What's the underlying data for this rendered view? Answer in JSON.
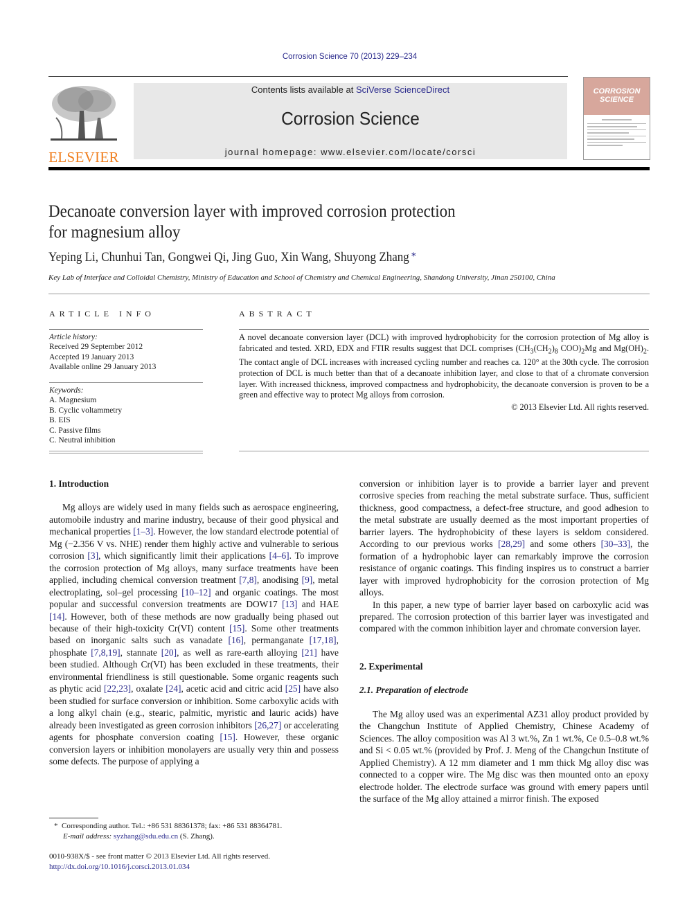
{
  "header": {
    "journal_reference": "Corrosion Science 70 (2013) 229–234",
    "publisher_logo_text": "ELSEVIER",
    "contents_prefix": "Contents lists available at ",
    "contents_link": "SciVerse ScienceDirect",
    "journal_title": "Corrosion Science",
    "homepage_label": "journal homepage: www.elsevier.com/locate/corsci",
    "cover_title_line1": "CORROSION",
    "cover_title_line2": "SCIENCE",
    "colors": {
      "link": "#2a2a8c",
      "elsevier_orange": "#f07e1d",
      "cover_pink": "#d7a79c",
      "banner_gray": "#e8e8e8"
    }
  },
  "article": {
    "title_line1": "Decanoate conversion layer with improved corrosion protection",
    "title_line2": "for magnesium alloy",
    "authors": "Yeping Li, Chunhui Tan, Gongwei Qi, Jing Guo, Xin Wang, Shuyong Zhang",
    "author_mark": "*",
    "affiliation": "Key Lab of Interface and Colloidal Chemistry, Ministry of Education and School of Chemistry and Chemical Engineering, Shandong University, Jinan 250100, China"
  },
  "article_info": {
    "heading": "ARTICLE INFO",
    "history_label": "Article history:",
    "history": [
      "Received 29 September 2012",
      "Accepted 19 January 2013",
      "Available online 29 January 2013"
    ],
    "keywords_label": "Keywords:",
    "keywords": [
      "A. Magnesium",
      "B. Cyclic voltammetry",
      "B. EIS",
      "C. Passive films",
      "C. Neutral inhibition"
    ]
  },
  "abstract": {
    "heading": "ABSTRACT",
    "text_1": "A novel decanoate conversion layer (DCL) with improved hydrophobicity for the corrosion protection of Mg alloy is fabricated and tested. XRD, EDX and FTIR results suggest that DCL comprises (CH",
    "sub_3": "3",
    "text_2": "(CH",
    "sub_2": "2",
    "text_3": ")",
    "sub_8": "8",
    "text_4": " COO)",
    "sub_2b": "2",
    "text_5": "Mg and Mg(OH)",
    "sub_2c": "2",
    "text_6": ". The contact angle of DCL increases with increased cycling number and reaches ca. 120° at the 30th cycle. The corrosion protection of DCL is much better than that of a decanoate inhibition layer, and close to that of a chromate conversion layer. With increased thickness, improved compactness and hydrophobicity, the decanoate conversion is proven to be a green and effective way to protect Mg alloys from corrosion.",
    "copyright": "© 2013 Elsevier Ltd. All rights reserved."
  },
  "body": {
    "intro_heading": "1. Introduction",
    "intro_p1": [
      {
        "t": "Mg alloys are widely used in many fields such as aerospace engineering, automobile industry and marine industry, because of their good physical and mechanical properties "
      },
      {
        "r": "[1–3]"
      },
      {
        "t": ". However, the low standard electrode potential of Mg (−2.356 V vs. NHE) render them highly active and vulnerable to serious corrosion "
      },
      {
        "r": "[3]"
      },
      {
        "t": ", which significantly limit their applications "
      },
      {
        "r": "[4–6]"
      },
      {
        "t": ". To improve the corrosion protection of Mg alloys, many surface treatments have been applied, including chemical conversion treatment "
      },
      {
        "r": "[7,8]"
      },
      {
        "t": ", anodising "
      },
      {
        "r": "[9]"
      },
      {
        "t": ", metal electroplating, sol–gel processing "
      },
      {
        "r": "[10–12]"
      },
      {
        "t": " and organic coatings. The most popular and successful conversion treatments are DOW17 "
      },
      {
        "r": "[13]"
      },
      {
        "t": " and HAE "
      },
      {
        "r": "[14]"
      },
      {
        "t": ". However, both of these methods are now gradually being phased out because of their high-toxicity Cr(VI) content "
      },
      {
        "r": "[15]"
      },
      {
        "t": ". Some other treatments based on inorganic salts such as vanadate "
      },
      {
        "r": "[16]"
      },
      {
        "t": ", permanganate "
      },
      {
        "r": "[17,18]"
      },
      {
        "t": ", phosphate "
      },
      {
        "r": "[7,8,19]"
      },
      {
        "t": ", stannate "
      },
      {
        "r": "[20]"
      },
      {
        "t": ", as well as rare-earth alloying "
      },
      {
        "r": "[21]"
      },
      {
        "t": " have been studied. Although Cr(VI) has been excluded in these treatments, their environmental friendliness is still questionable. Some organic reagents such as phytic acid "
      },
      {
        "r": "[22,23]"
      },
      {
        "t": ", oxalate "
      },
      {
        "r": "[24]"
      },
      {
        "t": ", acetic acid and citric acid "
      },
      {
        "r": "[25]"
      },
      {
        "t": " have also been studied for surface conversion or inhibition. Some carboxylic acids with a long alkyl chain (e.g., stearic, palmitic, myristic and lauric acids) have already been investigated as green corrosion inhibitors "
      },
      {
        "r": "[26,27]"
      },
      {
        "t": " or accelerating agents for phosphate conversion coating "
      },
      {
        "r": "[15]"
      },
      {
        "t": ". However, these organic conversion layers or inhibition monolayers are usually very thin and possess some defects. The purpose of applying a conversion or inhibition layer is to provide a barrier layer and prevent corrosive species from reaching the metal substrate surface. Thus, sufficient thickness, good compactness, a defect-free structure, and good adhesion to the metal substrate are usually deemed as the most important properties of barrier layers. The hydrophobicity of these layers is seldom considered. According to our previous works "
      },
      {
        "r": "[28,29]"
      },
      {
        "t": " and some others "
      },
      {
        "r": "[30–33]"
      },
      {
        "t": ", the formation of a hydrophobic layer can remarkably improve the corrosion resistance of organic coatings. This finding inspires us to construct a barrier layer with improved hydrophobicity for the corrosion protection of Mg alloys."
      }
    ],
    "intro_p2": "In this paper, a new type of barrier layer based on carboxylic acid was prepared. The corrosion protection of this barrier layer was investigated and compared with the common inhibition layer and chromate conversion layer.",
    "exp_heading": "2. Experimental",
    "exp_sub_heading": "2.1. Preparation of electrode",
    "exp_p1": "The Mg alloy used was an experimental AZ31 alloy product provided by the Changchun Institute of Applied Chemistry, Chinese Academy of Sciences. The alloy composition was Al 3 wt.%, Zn 1 wt.%, Ce 0.5–0.8 wt.% and Si < 0.05 wt.% (provided by Prof. J. Meng of the Changchun Institute of Applied Chemistry). A 12 mm diameter and 1 mm thick Mg alloy disc was connected to a copper wire. The Mg disc was then mounted onto an epoxy electrode holder. The electrode surface was ground with emery papers until the surface of the Mg alloy attained a mirror finish. The exposed"
  },
  "footnote": {
    "mark": "*",
    "contact": "Corresponding author. Tel.: +86 531 88361378; fax: +86 531 88364781.",
    "email_label": "E-mail address: ",
    "email": "syzhang@sdu.edu.cn",
    "email_suffix": " (S. Zhang)."
  },
  "bottom": {
    "issn_line": "0010-938X/$ - see front matter © 2013 Elsevier Ltd. All rights reserved.",
    "doi": "http://dx.doi.org/10.1016/j.corsci.2013.01.034"
  }
}
